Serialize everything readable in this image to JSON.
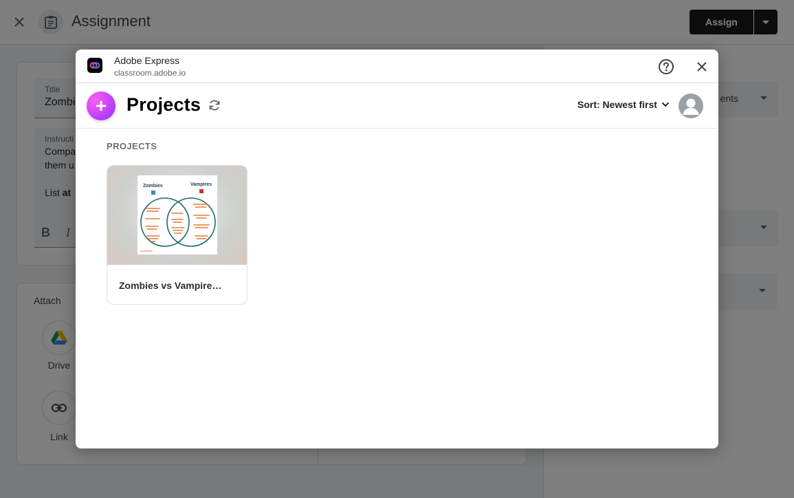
{
  "background": {
    "header": {
      "title": "Assignment",
      "assign_label": "Assign"
    },
    "form": {
      "title_label": "Title",
      "title_value": "Zombi",
      "instructions_label": "Instructi",
      "instructions_line1": "Compa",
      "instructions_line2": "them u",
      "instructions_line3_prefix": "List ",
      "instructions_line3_bold": "at",
      "bold_label": "B",
      "italic_label": "I"
    },
    "attach": {
      "title": "Attach",
      "items": [
        {
          "label": "Drive",
          "icon": "google-drive-icon"
        },
        {
          "label": "Link",
          "icon": "link-icon"
        }
      ]
    },
    "side": {
      "select1_text": "ents"
    }
  },
  "modal": {
    "app_name": "Adobe Express",
    "app_url": "classroom.adobe.io",
    "heading": "Projects",
    "add_label": "+",
    "sort_label": "Sort: Newest first",
    "section_label": "PROJECTS",
    "projects": [
      {
        "title": "Zombies vs Vampire…",
        "thumb": {
          "left_heading": "Zombies",
          "right_heading": "Vampires"
        }
      }
    ]
  },
  "colors": {
    "accent_add": "#b53bff",
    "assign_bg": "#1a1a1a",
    "venn_stroke": "#1e6b6f",
    "venn_text": "#e07a3a"
  }
}
